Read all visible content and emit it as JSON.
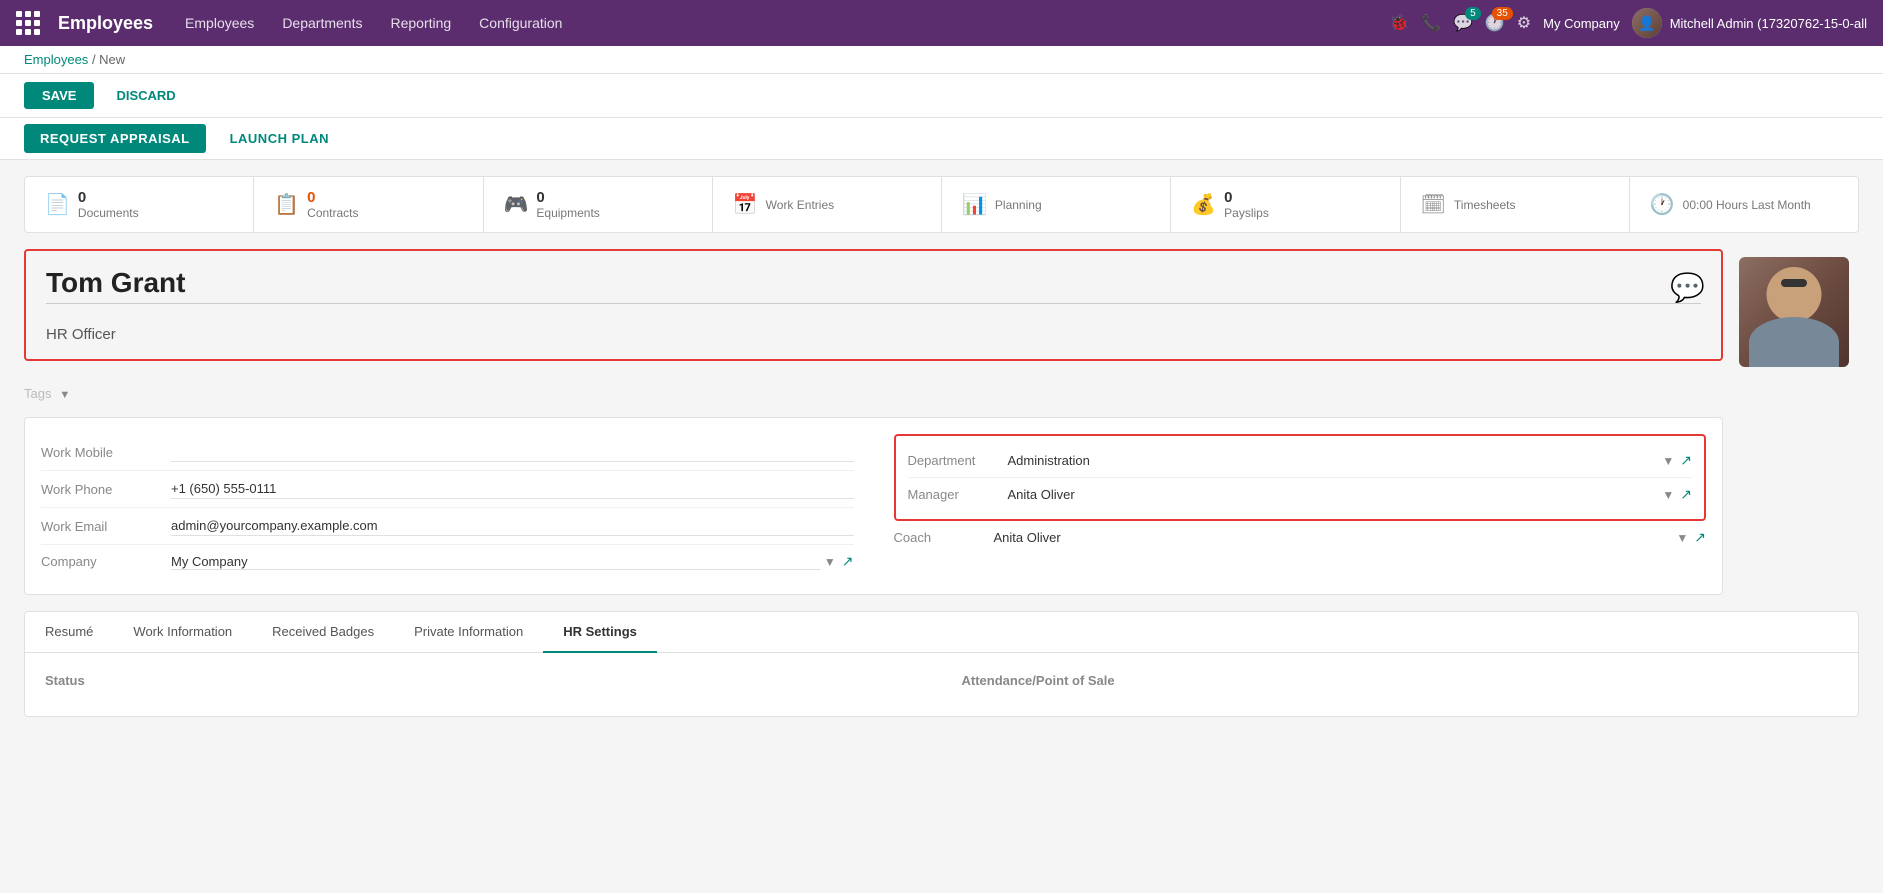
{
  "topnav": {
    "brand": "Employees",
    "menu": [
      "Employees",
      "Departments",
      "Reporting",
      "Configuration"
    ],
    "icons": {
      "bug": "🐞",
      "phone": "📞",
      "chat": "💬",
      "chat_badge": "5",
      "clock": "🕐",
      "clock_badge": "35",
      "settings": "⚙"
    },
    "company": "My Company",
    "user": "Mitchell Admin (17320762-15-0-all"
  },
  "breadcrumb": {
    "parent": "Employees",
    "current": "New"
  },
  "buttons": {
    "save": "SAVE",
    "discard": "DISCARD",
    "request_appraisal": "REQUEST APPRAISAL",
    "launch_plan": "LAUNCH PLAN"
  },
  "stat_tabs": [
    {
      "icon": "📄",
      "count": "0",
      "label": "Documents"
    },
    {
      "icon": "📋",
      "count": "0",
      "label": "Contracts",
      "count_color": "orange"
    },
    {
      "icon": "🎮",
      "count": "0",
      "label": "Equipments"
    },
    {
      "icon": "📅",
      "count": "",
      "label": "Work Entries"
    },
    {
      "icon": "📊",
      "count": "",
      "label": "Planning"
    },
    {
      "icon": "💰",
      "count": "0",
      "label": "Payslips"
    },
    {
      "icon": "🗓",
      "count": "",
      "label": "Timesheets"
    },
    {
      "icon": "🕐",
      "count": "",
      "label": "00:00 Hours Last Month"
    }
  ],
  "employee": {
    "name": "Tom Grant",
    "job_title": "HR Officer",
    "tags_placeholder": "Tags",
    "work_mobile": "",
    "work_phone": "+1 (650) 555-0111",
    "work_email": "admin@yourcompany.example.com",
    "company": "My Company",
    "department": "Administration",
    "manager": "Anita Oliver",
    "coach": "Anita Oliver"
  },
  "fields": {
    "work_mobile_label": "Work Mobile",
    "work_phone_label": "Work Phone",
    "work_email_label": "Work Email",
    "company_label": "Company",
    "department_label": "Department",
    "manager_label": "Manager",
    "coach_label": "Coach"
  },
  "tabs": [
    {
      "id": "resume",
      "label": "Resumé",
      "active": false
    },
    {
      "id": "work-information",
      "label": "Work Information",
      "active": false
    },
    {
      "id": "received-badges",
      "label": "Received Badges",
      "active": false
    },
    {
      "id": "private-information",
      "label": "Private Information",
      "active": false
    },
    {
      "id": "hr-settings",
      "label": "HR Settings",
      "active": true
    }
  ],
  "bottom_section": {
    "status_label": "Status",
    "attendance_label": "Attendance/Point of Sale"
  }
}
